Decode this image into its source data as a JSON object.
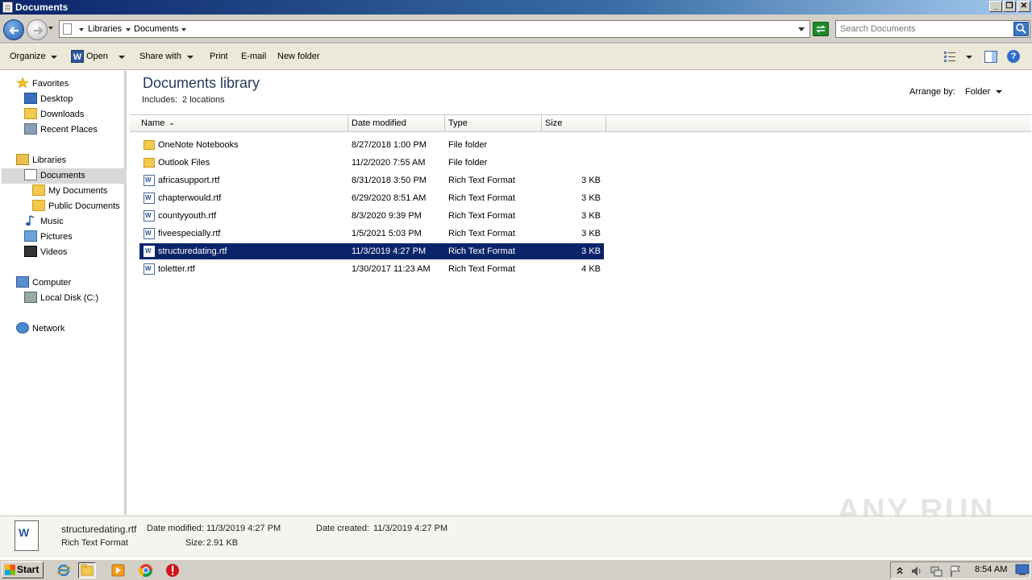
{
  "window": {
    "title": "Documents"
  },
  "address": {
    "crumbs": [
      "Libraries",
      "Documents"
    ],
    "search_placeholder": "Search Documents"
  },
  "toolbar": {
    "organize": "Organize",
    "open": "Open",
    "share_with": "Share with",
    "print": "Print",
    "email": "E-mail",
    "new_folder": "New folder"
  },
  "nav": {
    "favorites": "Favorites",
    "desktop": "Desktop",
    "downloads": "Downloads",
    "recent_places": "Recent Places",
    "libraries": "Libraries",
    "documents": "Documents",
    "my_documents": "My Documents",
    "public_documents": "Public Documents",
    "music": "Music",
    "pictures": "Pictures",
    "videos": "Videos",
    "computer": "Computer",
    "local_disk": "Local Disk (C:)",
    "network": "Network"
  },
  "library": {
    "title": "Documents library",
    "includes_label": "Includes:",
    "includes_value": "2 locations",
    "arrange_label": "Arrange by:",
    "arrange_value": "Folder"
  },
  "columns": {
    "name": "Name",
    "date": "Date modified",
    "type": "Type",
    "size": "Size"
  },
  "files": [
    {
      "name": "OneNote Notebooks",
      "date": "8/27/2018 1:00 PM",
      "type": "File folder",
      "size": "",
      "kind": "folder"
    },
    {
      "name": "Outlook Files",
      "date": "11/2/2020 7:55 AM",
      "type": "File folder",
      "size": "",
      "kind": "folder"
    },
    {
      "name": "africasupport.rtf",
      "date": "8/31/2018 3:50 PM",
      "type": "Rich Text Format",
      "size": "3 KB",
      "kind": "rtf"
    },
    {
      "name": "chapterwould.rtf",
      "date": "6/29/2020 8:51 AM",
      "type": "Rich Text Format",
      "size": "3 KB",
      "kind": "rtf"
    },
    {
      "name": "countyyouth.rtf",
      "date": "8/3/2020 9:39 PM",
      "type": "Rich Text Format",
      "size": "3 KB",
      "kind": "rtf"
    },
    {
      "name": "fiveespecially.rtf",
      "date": "1/5/2021 5:03 PM",
      "type": "Rich Text Format",
      "size": "3 KB",
      "kind": "rtf"
    },
    {
      "name": "structuredating.rtf",
      "date": "11/3/2019 4:27 PM",
      "type": "Rich Text Format",
      "size": "3 KB",
      "kind": "rtf",
      "selected": true
    },
    {
      "name": "toletter.rtf",
      "date": "1/30/2017 11:23 AM",
      "type": "Rich Text Format",
      "size": "4 KB",
      "kind": "rtf"
    }
  ],
  "details": {
    "filename": "structuredating.rtf",
    "type": "Rich Text Format",
    "modified_label": "Date modified:",
    "modified_value": "11/3/2019 4:27 PM",
    "created_label": "Date created:",
    "created_value": "11/3/2019 4:27 PM",
    "size_label": "Size:",
    "size_value": "2.91 KB"
  },
  "watermark": "ANY RUN",
  "taskbar": {
    "start": "Start",
    "clock": "8:54 AM"
  }
}
